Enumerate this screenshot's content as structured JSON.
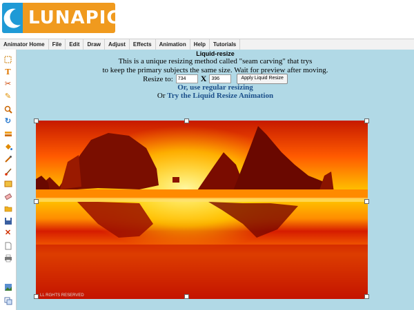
{
  "logo": {
    "text": "LUNAPIC"
  },
  "menu": [
    "Animator Home",
    "File",
    "Edit",
    "Draw",
    "Adjust",
    "Effects",
    "Animation",
    "Help",
    "Tutorials"
  ],
  "toolbar_icons": [
    "select-icon",
    "text-icon",
    "scissors-icon",
    "pencil-icon",
    "zoom-icon",
    "rotate-icon",
    "layers-icon",
    "paint-bucket-icon",
    "eyedropper-icon",
    "brush-icon",
    "crop-icon",
    "eraser-icon",
    "open-folder-icon",
    "save-icon",
    "close-icon",
    "new-file-icon",
    "print-icon",
    "image-icon",
    "copy-icon"
  ],
  "content": {
    "title": "Liquid-resize",
    "desc_line1": "This is a unique resizing method called \"seam carving\" that trys",
    "desc_line2": "to keep the primary subjects the same size. Wait for preview after moving.",
    "resize_label": "Resize to:",
    "width_value": "734",
    "height_value": "396",
    "separator": "X",
    "apply_button": "Apply Liquid Resize",
    "regular_link": "Or, use regular resizing",
    "animation_prefix": "Or",
    "animation_link": "Try the Liquid Resize Animation"
  },
  "image": {
    "watermark": "LL RGHTS RESERVED"
  },
  "colors": {
    "logo_orange": "#f09a1e",
    "logo_blue": "#1f9ad6",
    "panel_bg": "#b1d9e6",
    "link": "#1b4f8a"
  }
}
